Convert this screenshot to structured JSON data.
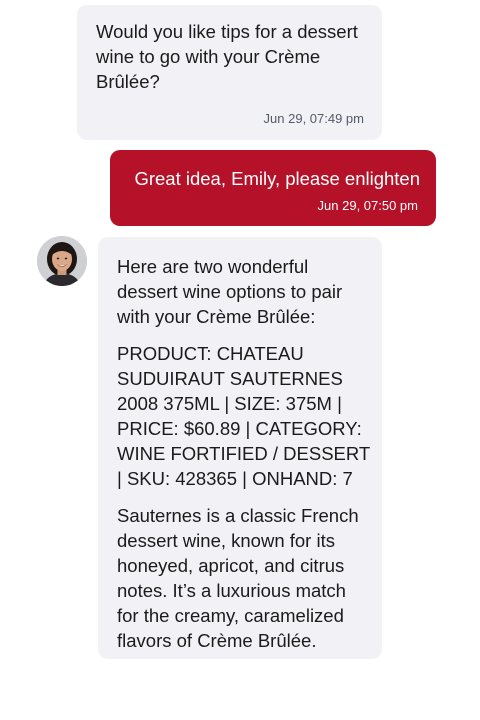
{
  "messages": [
    {
      "sender": "agent",
      "text": "Would you like tips for a dessert wine to go with your Crème Brûlée?",
      "timestamp": "Jun 29, 07:49 pm"
    },
    {
      "sender": "user",
      "text": "Great idea, Emily, please enlighten",
      "timestamp": "Jun 29, 07:50 pm"
    },
    {
      "sender": "agent",
      "paragraphs": [
        "Here are two wonderful dessert wine options to pair with your Crème Brûlée:",
        "PRODUCT: CHATEAU SUDUIRAUT SAUTERNES 2008 375ML | SIZE: 375M | PRICE: $60.89 | CATEGORY: WINE FORTIFIED / DESSERT | SKU: 428365 | ONHAND: 7",
        "Sauternes is a classic French dessert wine, known for its honeyed, apricot, and citrus notes. It’s a luxurious match for the creamy, caramelized flavors of Crème Brûlée."
      ],
      "avatar": "agent-avatar-photo"
    }
  ],
  "colors": {
    "incoming_bubble": "#f1f1f6",
    "outgoing_bubble": "#b5122a",
    "outgoing_text": "#ffffff",
    "timestamp_text": "#555a66"
  }
}
